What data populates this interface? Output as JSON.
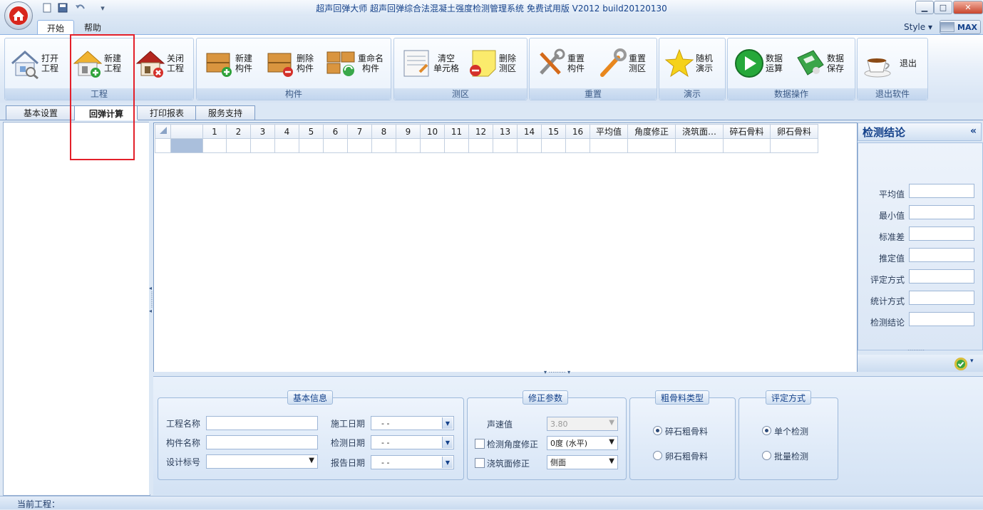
{
  "window": {
    "title": "超声回弹大师 超声回弹综合法混凝土强度检测管理系统 免费试用版 V2012 build20120130"
  },
  "ribbon_tabs": [
    "开始",
    "帮助"
  ],
  "style_label": "Style",
  "max_label": "MAX",
  "ribbon_groups": {
    "project": {
      "caption": "工程",
      "open": "打开\n工程",
      "new": "新建\n工程",
      "close": "关闭\n工程"
    },
    "component": {
      "caption": "构件",
      "new": "新建\n构件",
      "delete": "删除\n构件",
      "rename": "重命名\n构件"
    },
    "zone": {
      "caption": "测区",
      "clear": "清空\n单元格",
      "delete": "删除\n测区"
    },
    "reset": {
      "caption": "重置",
      "component": "重置\n构件",
      "zone": "重置\n测区"
    },
    "demo": {
      "caption": "演示",
      "random": "随机\n演示"
    },
    "data": {
      "caption": "数据操作",
      "calc": "数据\n运算",
      "save": "数据\n保存"
    },
    "exit": {
      "caption": "退出软件",
      "exit": "退出"
    }
  },
  "page_tabs": [
    "基本设置",
    "回弹计算",
    "打印报表",
    "服务支持"
  ],
  "grid": {
    "headers": [
      "1",
      "2",
      "3",
      "4",
      "5",
      "6",
      "7",
      "8",
      "9",
      "10",
      "11",
      "12",
      "13",
      "14",
      "15",
      "16",
      "平均值",
      "角度修正",
      "浇筑面…",
      "碎石骨料",
      "卵石骨料"
    ]
  },
  "right_panel": {
    "title": "检测结论",
    "collapse": "«",
    "fields": [
      "平均值",
      "最小值",
      "标准差",
      "推定值",
      "评定方式",
      "统计方式",
      "检测结论"
    ]
  },
  "basic_info": {
    "legend": "基本信息",
    "project_name": "工程名称",
    "component_name": "构件名称",
    "design_grade": "设计标号",
    "construction_date": "施工日期",
    "inspection_date": "检测日期",
    "report_date": "报告日期",
    "date_placeholder": "-   -"
  },
  "correction": {
    "legend": "修正参数",
    "sound_speed_label": "声速值",
    "sound_speed_value": "3.80",
    "angle_label": "检测角度修正",
    "angle_value": "0度 (水平)",
    "pour_label": "浇筑面修正",
    "pour_value": "侧面"
  },
  "aggregate": {
    "legend": "粗骨料类型",
    "crushed": "碎石粗骨料",
    "pebble": "卵石粗骨料"
  },
  "evaluation": {
    "legend": "评定方式",
    "single": "单个检测",
    "batch": "批量检测"
  },
  "status": {
    "current_project": "当前工程："
  },
  "colors": {
    "accent": "#15428b",
    "highlight": "#e3202a"
  }
}
